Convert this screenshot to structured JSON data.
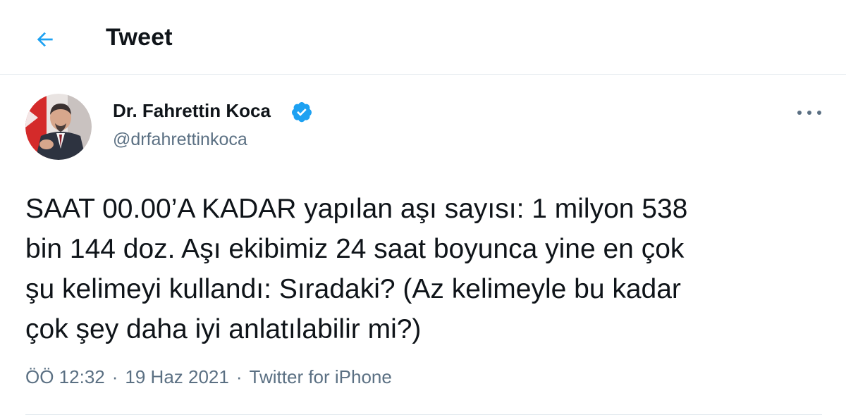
{
  "colors": {
    "accent": "#1da1f2",
    "text_primary": "#0f1419",
    "text_secondary": "#5b7083",
    "divider": "#e6ecf0"
  },
  "header": {
    "back_icon": "arrow-left-icon",
    "title": "Tweet"
  },
  "author": {
    "display_name": "Dr. Fahrettin Koca",
    "verified_icon": "verified-badge-icon",
    "handle": "@drfahrettinkoca",
    "avatar_icon": "profile-photo"
  },
  "more_icon": "more-horizontal-icon",
  "tweet": {
    "text": "SAAT 00.00’A KADAR yapılan aşı sayısı: 1 milyon 538\nbin 144 doz. Aşı ekibimiz 24 saat boyunca yine en çok\nşu kelimeyi kullandı: Sıradaki? (Az kelimeyle bu kadar\nçok şey daha iyi anlatılabilir mi?)",
    "time": "ÖÖ 12:32",
    "separator": "·",
    "date": "19 Haz 2021",
    "source": "Twitter for iPhone"
  }
}
